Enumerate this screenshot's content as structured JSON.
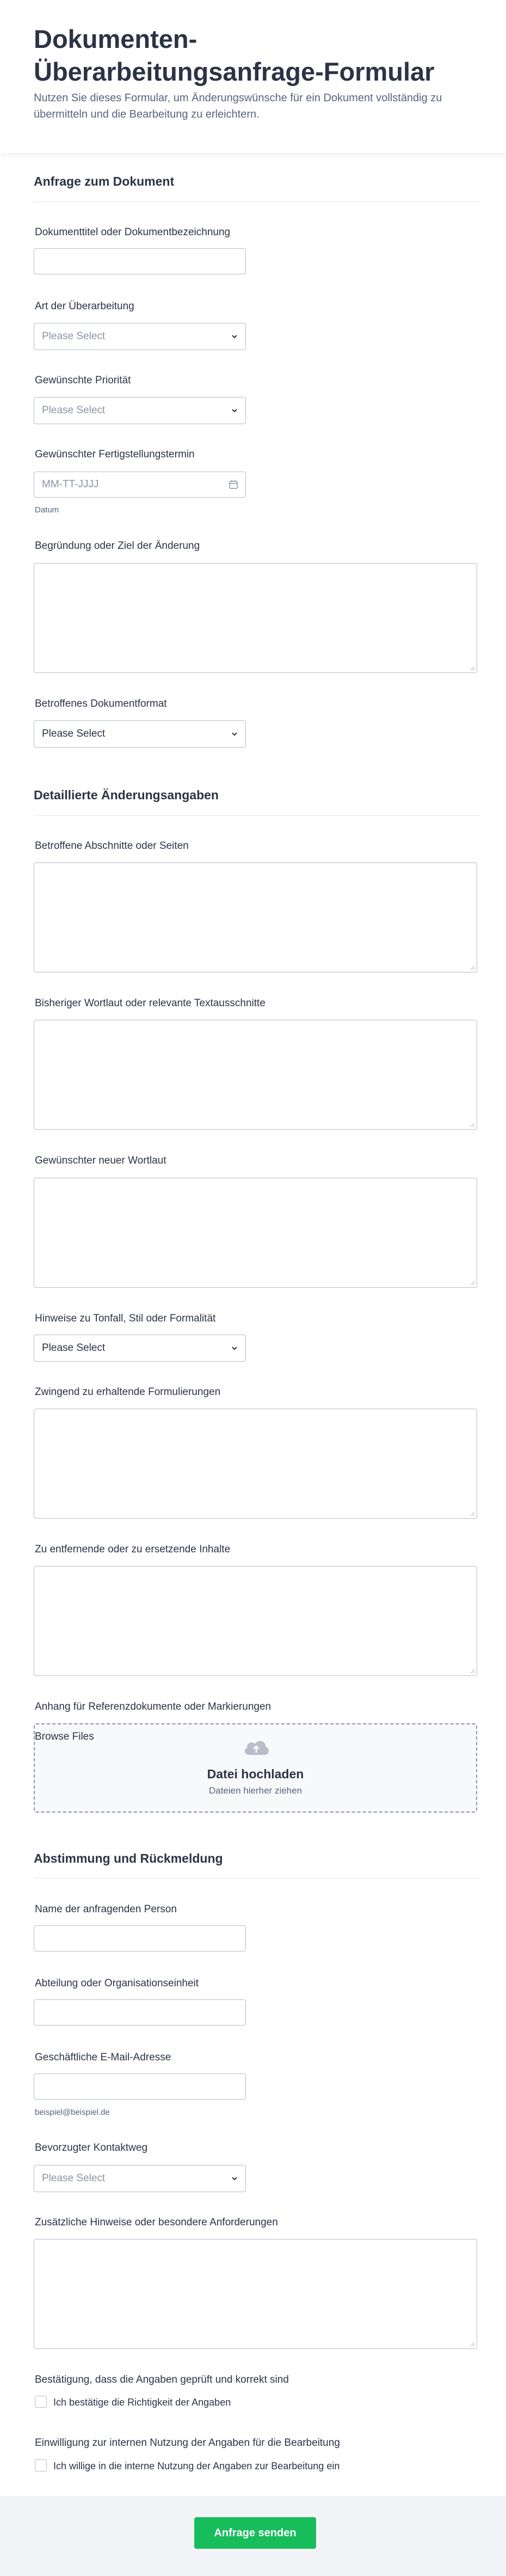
{
  "header": {
    "title": "Dokumenten-Überarbeitungsanfrage-Formular",
    "subtitle": "Nutzen Sie dieses Formular, um Änderungswünsche für ein Dokument vollständig zu übermitteln und die Bearbeitung zu erleichtern."
  },
  "sections": {
    "s1": "Anfrage zum Dokument",
    "s2": "Detaillierte Änderungsangaben",
    "s3": "Abstimmung und Rückmeldung"
  },
  "fields": {
    "doc_title": {
      "label": "Dokumenttitel oder Dokumentbezeichnung",
      "value": ""
    },
    "revision_type": {
      "label": "Art der Überarbeitung",
      "placeholder": "Please Select"
    },
    "priority": {
      "label": "Gewünschte Priorität",
      "placeholder": "Please Select"
    },
    "due_date": {
      "label": "Gewünschter Fertigstellungstermin",
      "placeholder": "MM-TT-JJJJ",
      "sublabel": "Datum"
    },
    "reason": {
      "label": "Begründung oder Ziel der Änderung"
    },
    "format": {
      "label": "Betroffenes Dokumentformat",
      "value": "Please Select"
    },
    "sections_affected": {
      "label": "Betroffene Abschnitte oder Seiten"
    },
    "current_wording": {
      "label": "Bisheriger Wortlaut oder relevante Textausschnitte"
    },
    "new_wording": {
      "label": "Gewünschter neuer Wortlaut"
    },
    "tone": {
      "label": "Hinweise zu Tonfall, Stil oder Formalität",
      "value": "Please Select"
    },
    "keep_phrases": {
      "label": "Zwingend zu erhaltende Formulierungen"
    },
    "remove_content": {
      "label": "Zu entfernende oder zu ersetzende Inhalte"
    },
    "attachment": {
      "label": "Anhang für Referenzdokumente oder Markierungen",
      "browse": "Browse Files",
      "title": "Datei hochladen",
      "subtitle": "Dateien hierher ziehen"
    },
    "requester_name": {
      "label": "Name der anfragenden Person"
    },
    "department": {
      "label": "Abteilung oder Organisationseinheit"
    },
    "email": {
      "label": "Geschäftliche E-Mail-Adresse",
      "sublabel": "beispiel@beispiel.de"
    },
    "contact_method": {
      "label": "Bevorzugter Kontaktweg",
      "placeholder": "Please Select"
    },
    "notes": {
      "label": "Zusätzliche Hinweise oder besondere Anforderungen"
    },
    "confirm": {
      "label": "Bestätigung, dass die Angaben geprüft und korrekt sind",
      "option": "Ich bestätige die Richtigkeit der Angaben"
    },
    "consent": {
      "label": "Einwilligung zur internen Nutzung der Angaben für die Bearbeitung",
      "option": "Ich willige in die interne Nutzung der Angaben zur Bearbeitung ein"
    }
  },
  "submit": {
    "label": "Anfrage senden"
  },
  "colors": {
    "accent": "#18bd5b",
    "text": "#2c3345",
    "muted": "#57647e",
    "border": "#b8bdc9"
  },
  "icons": [
    "chevron-down-icon",
    "calendar-icon",
    "upload-cloud-icon",
    "resize-grip-icon"
  ]
}
